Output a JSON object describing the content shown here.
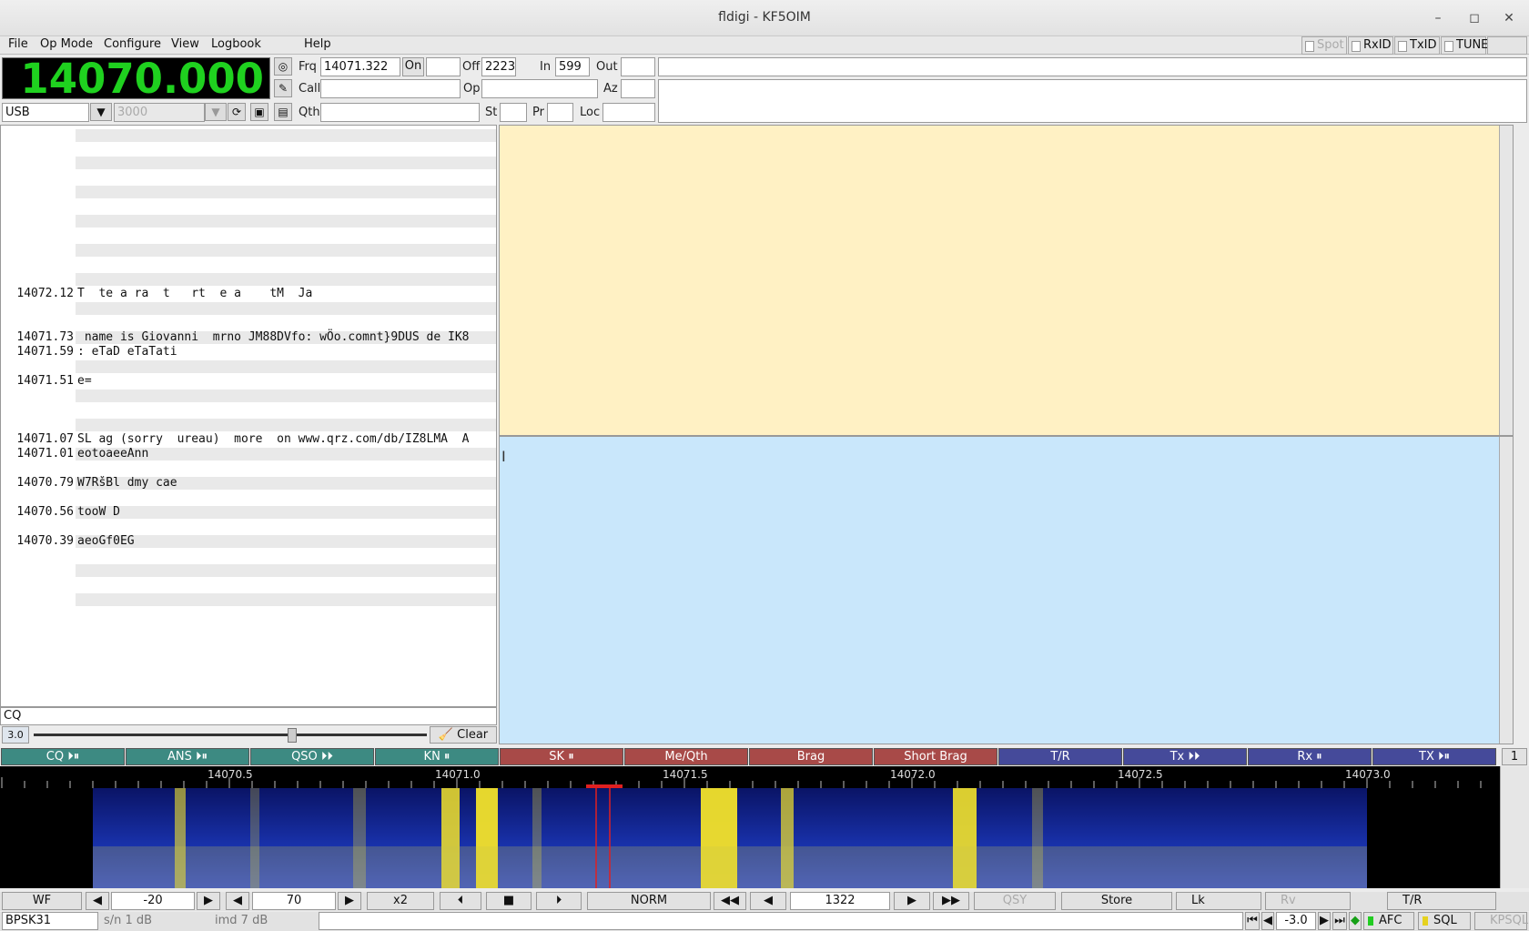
{
  "window": {
    "title": "fldigi - KF5OIM",
    "min": "–",
    "max": "◻",
    "close": "✕"
  },
  "menu": [
    "File",
    "Op Mode",
    "Configure",
    "View",
    "Logbook",
    "Help"
  ],
  "toggles": {
    "spot": "Spot",
    "rxid": "RxID",
    "txid": "TxID",
    "tune": "TUNE"
  },
  "freq_display": "14070.000",
  "log": {
    "frq_label": "Frq",
    "frq": "14071.322",
    "on_label": "On",
    "on": "",
    "off_label": "Off",
    "off": "2223",
    "in_label": "In",
    "in": "599",
    "out_label": "Out",
    "out": "",
    "call_label": "Call",
    "call": "",
    "op_label": "Op",
    "op": "",
    "az_label": "Az",
    "az": "",
    "qth_label": "Qth",
    "qth": "",
    "st_label": "St",
    "st": "",
    "pr_label": "Pr",
    "pr": "",
    "loc_label": "Loc",
    "loc": ""
  },
  "mode_select": "USB",
  "bw_select": "3000",
  "rx_rows": [
    {
      "freq": "14072.12",
      "text": "T  te a ra  t   rt  e a    tM  Ja"
    },
    {
      "freq": "14071.73",
      "text": " name is Giovanni  mrno JM88DVfo: wÖo.comnt}9DUS de IK8"
    },
    {
      "freq": "14071.59",
      "text": ": eTaD eTaTati"
    },
    {
      "freq": "14071.51",
      "text": "e="
    },
    {
      "freq": "14071.07",
      "text": "SL ag (sorry  ureau)  more  on www.qrz.com/db/IZ8LMA  A"
    },
    {
      "freq": "14071.01",
      "text": "eotoaeeAnn"
    },
    {
      "freq": "14070.79",
      "text": "W7RšBl dmy cae"
    },
    {
      "freq": "14070.56",
      "text": "tooW D"
    },
    {
      "freq": "14070.39",
      "text": "aeoGf0EG"
    }
  ],
  "search_field": "CQ",
  "squelch_value": "3.0",
  "clear_label": "Clear",
  "macros": [
    {
      "label": "CQ ⏵⏸",
      "color": "#3d8a82"
    },
    {
      "label": "ANS ⏵⏸",
      "color": "#3d8a82"
    },
    {
      "label": "QSO ⏵⏵",
      "color": "#3d8a82"
    },
    {
      "label": "KN ⏸",
      "color": "#3d8a82"
    },
    {
      "label": "SK ⏸",
      "color": "#a84a48"
    },
    {
      "label": "Me/Qth",
      "color": "#a84a48"
    },
    {
      "label": "Brag",
      "color": "#a84a48"
    },
    {
      "label": "Short Brag",
      "color": "#a84a48"
    },
    {
      "label": "T/R",
      "color": "#454a9a"
    },
    {
      "label": "Tx ⏵⏵",
      "color": "#454a9a"
    },
    {
      "label": "Rx ⏸",
      "color": "#454a9a"
    },
    {
      "label": "TX ⏵⏸",
      "color": "#454a9a"
    }
  ],
  "macro_page": "1",
  "scale_ticks": [
    "14070.5",
    "14071.0",
    "14071.5",
    "14072.0",
    "14072.5",
    "14073.0"
  ],
  "controls": {
    "wf": "WF",
    "ref": "-20",
    "range": "70",
    "zoom": "x2",
    "norm": "NORM",
    "carrier": "1322",
    "qsy": "QSY",
    "store": "Store",
    "lk": "Lk",
    "rv": "Rv",
    "tr": "T/R"
  },
  "status": {
    "mode": "BPSK31",
    "sn": "s/n  1 dB",
    "imd": "imd  7 dB",
    "afc_val": "-3.0",
    "afc": "AFC",
    "sql": "SQL",
    "kpsql": "KPSQL"
  }
}
